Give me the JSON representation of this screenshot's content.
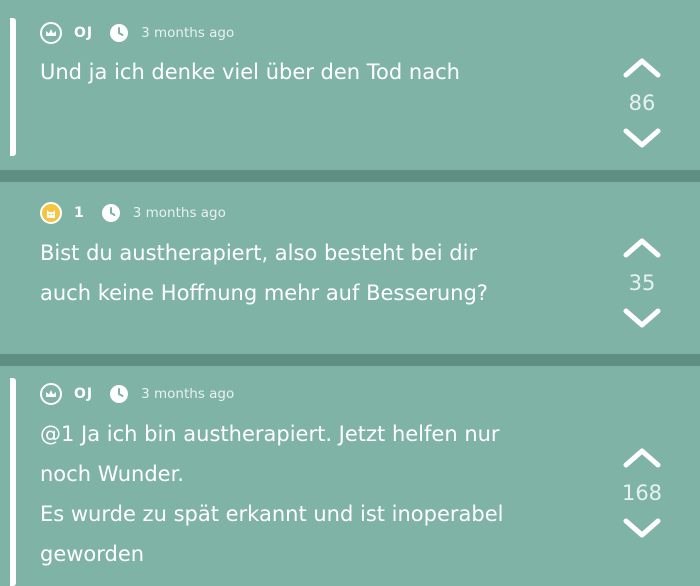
{
  "posts": [
    {
      "username": "OJ",
      "avatar_icon": "crown-icon",
      "time": "3 months ago",
      "lines": [
        "Und ja ich denke viel über den Tod nach"
      ],
      "votes": "86"
    },
    {
      "username": "1",
      "avatar_icon": "cat-icon",
      "time": "3 months ago",
      "lines": [
        "Bist du austherapiert, also besteht bei dir",
        "auch keine Hoffnung mehr auf Besserung?"
      ],
      "votes": "35"
    },
    {
      "username": "OJ",
      "avatar_icon": "crown-icon",
      "time": "3 months ago",
      "lines": [
        "@1 Ja ich bin austherapiert. Jetzt helfen nur",
        "noch Wunder.",
        "Es wurde zu spät erkannt und ist inoperabel",
        "geworden"
      ],
      "votes": "168"
    }
  ],
  "colors": {
    "background": "#7fb3a5",
    "divider": "#5f8f80",
    "text": "#ffffff",
    "cat_avatar": "#f5c542"
  }
}
